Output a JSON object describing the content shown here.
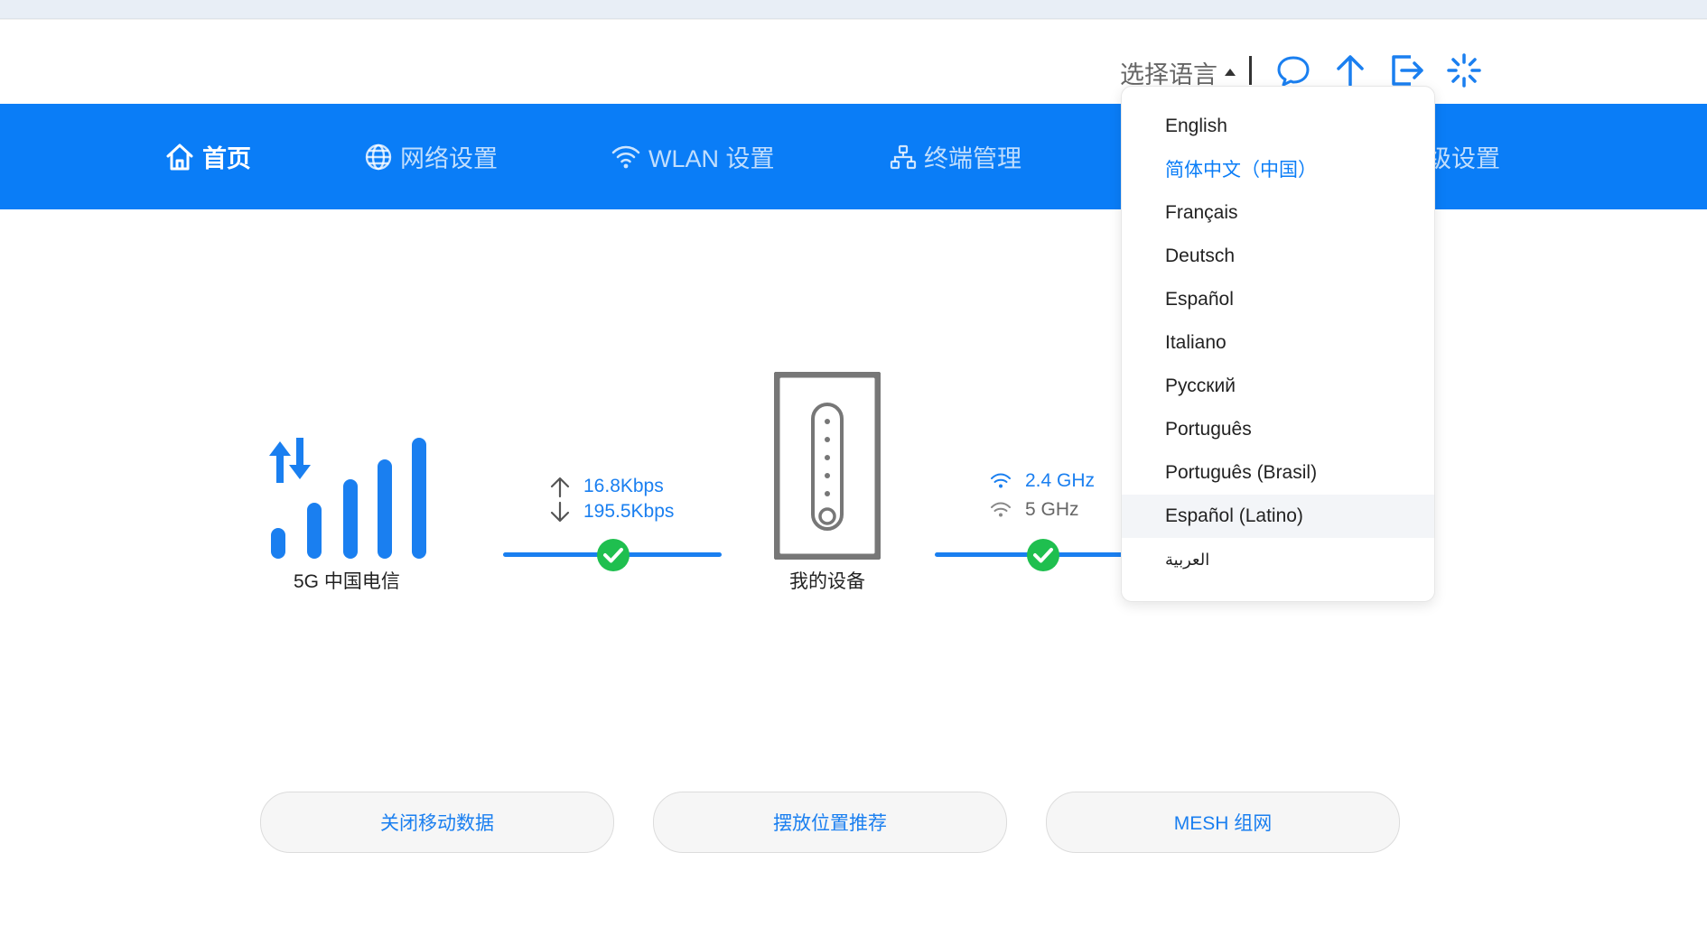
{
  "header": {
    "language_label": "选择语言"
  },
  "nav": {
    "items": [
      {
        "label": "首页"
      },
      {
        "label": "网络设置"
      },
      {
        "label": "WLAN 设置"
      },
      {
        "label": "终端管理"
      },
      {
        "label": "级设置"
      }
    ]
  },
  "language_dropdown": {
    "options": [
      "English",
      "简体中文（中国）",
      "Français",
      "Deutsch",
      "Español",
      "Italiano",
      "Русский",
      "Português",
      "Português (Brasil)",
      "Español (Latino)",
      "العربية"
    ],
    "selected": "简体中文（中国）",
    "hovered": "Español (Latino)"
  },
  "status": {
    "network_label": "5G 中国电信",
    "upload_speed": "16.8Kbps",
    "download_speed": "195.5Kbps",
    "device_label": "我的设备",
    "wifi_24": "2.4 GHz",
    "wifi_5": "5 GHz"
  },
  "actions": {
    "mobile_data": "关闭移动数据",
    "placement": "摆放位置推荐",
    "mesh": "MESH 组网"
  },
  "colors": {
    "primary": "#0a7df7",
    "link_blue": "#1a7ff0",
    "ok_green": "#1fbf4f"
  }
}
